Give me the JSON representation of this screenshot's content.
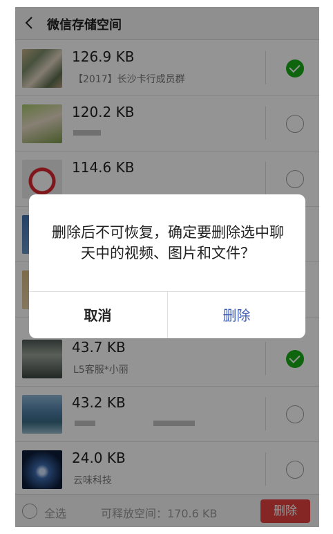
{
  "header": {
    "back_icon": "chevron-left-icon",
    "title": "微信存储空间"
  },
  "rows": [
    {
      "size": "126.9 KB",
      "name": "【2017】长沙卡行成员群",
      "checked": true
    },
    {
      "size": "120.2 KB",
      "name": "",
      "checked": false
    },
    {
      "size": "114.6 KB",
      "name": "",
      "checked": false
    },
    {
      "size": "",
      "name": "",
      "checked": false
    },
    {
      "size": "",
      "name": "",
      "checked": false
    },
    {
      "size": "43.7 KB",
      "name": "L5客服*小丽",
      "checked": true
    },
    {
      "size": "43.2 KB",
      "name": "",
      "checked": false
    },
    {
      "size": "24.0 KB",
      "name": "云味科技",
      "checked": false
    }
  ],
  "footer": {
    "select_all": "全选",
    "free_space": "可释放空间：170.6 KB",
    "delete": "删除"
  },
  "dialog": {
    "message": "删除后不可恢复，确定要删除选中聊天中的视频、图片和文件？",
    "cancel": "取消",
    "confirm": "删除"
  },
  "colors": {
    "accent_green": "#1aad19",
    "delete_red": "#e64340",
    "confirm_blue": "#3f5db2"
  }
}
